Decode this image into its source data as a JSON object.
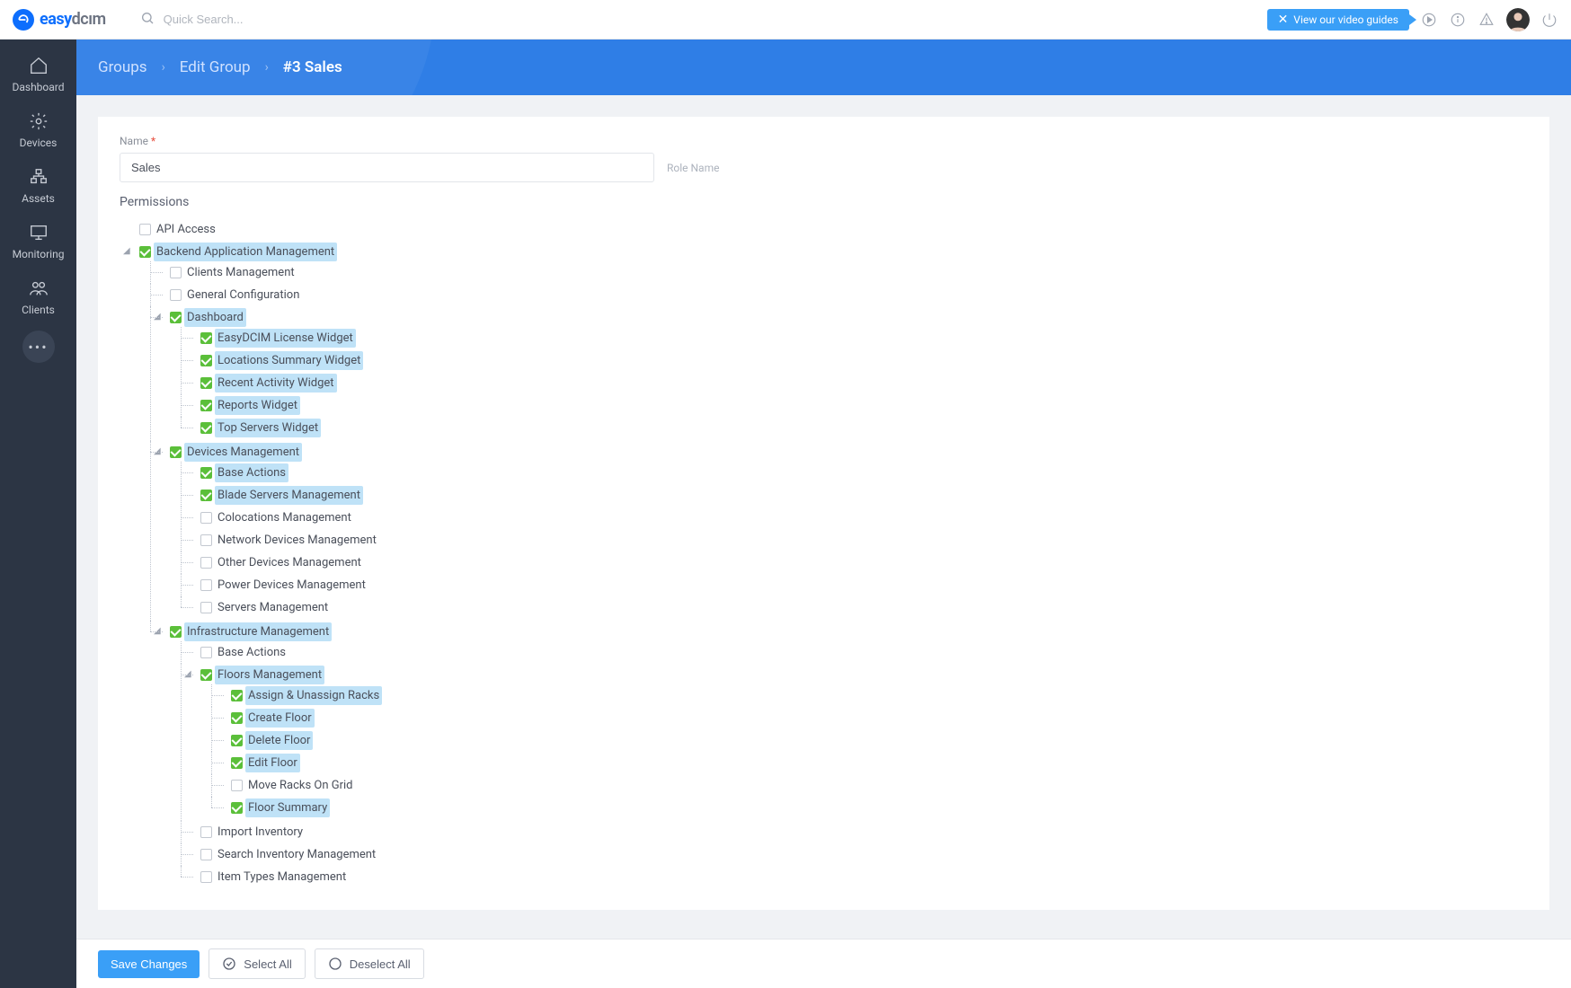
{
  "brand": {
    "name_prefix": "easy",
    "name_suffix": "dcım"
  },
  "topbar": {
    "search_placeholder": "Quick Search...",
    "video_guide_label": "View our video guides"
  },
  "sidebar": {
    "items": [
      {
        "label": "Dashboard"
      },
      {
        "label": "Devices"
      },
      {
        "label": "Assets"
      },
      {
        "label": "Monitoring"
      },
      {
        "label": "Clients"
      }
    ]
  },
  "breadcrumb": {
    "l1": "Groups",
    "l2": "Edit Group",
    "l3": "#3 Sales"
  },
  "form": {
    "name_label": "Name",
    "name_value": "Sales",
    "name_hint": "Role Name",
    "permissions_title": "Permissions"
  },
  "tree": {
    "n0": "API Access",
    "n1": "Backend Application Management",
    "n1_0": "Clients Management",
    "n1_1": "General Configuration",
    "n1_2": "Dashboard",
    "n1_2_0": "EasyDCIM License Widget",
    "n1_2_1": "Locations Summary Widget",
    "n1_2_2": "Recent Activity Widget",
    "n1_2_3": "Reports Widget",
    "n1_2_4": "Top Servers Widget",
    "n1_3": "Devices Management",
    "n1_3_0": "Base Actions",
    "n1_3_1": "Blade Servers Management",
    "n1_3_2": "Colocations Management",
    "n1_3_3": "Network Devices Management",
    "n1_3_4": "Other Devices Management",
    "n1_3_5": "Power Devices Management",
    "n1_3_6": "Servers Management",
    "n1_4": "Infrastructure Management",
    "n1_4_0": "Base Actions",
    "n1_4_1": "Floors Management",
    "n1_4_1_0": "Assign & Unassign Racks",
    "n1_4_1_1": "Create Floor",
    "n1_4_1_2": "Delete Floor",
    "n1_4_1_3": "Edit Floor",
    "n1_4_1_4": "Move Racks On Grid",
    "n1_4_1_5": "Floor Summary",
    "n1_4_2": "Import Inventory",
    "n1_4_3": "Search Inventory Management",
    "n1_4_4": "Item Types Management"
  },
  "footer": {
    "save": "Save Changes",
    "select_all": "Select All",
    "deselect_all": "Deselect All"
  }
}
